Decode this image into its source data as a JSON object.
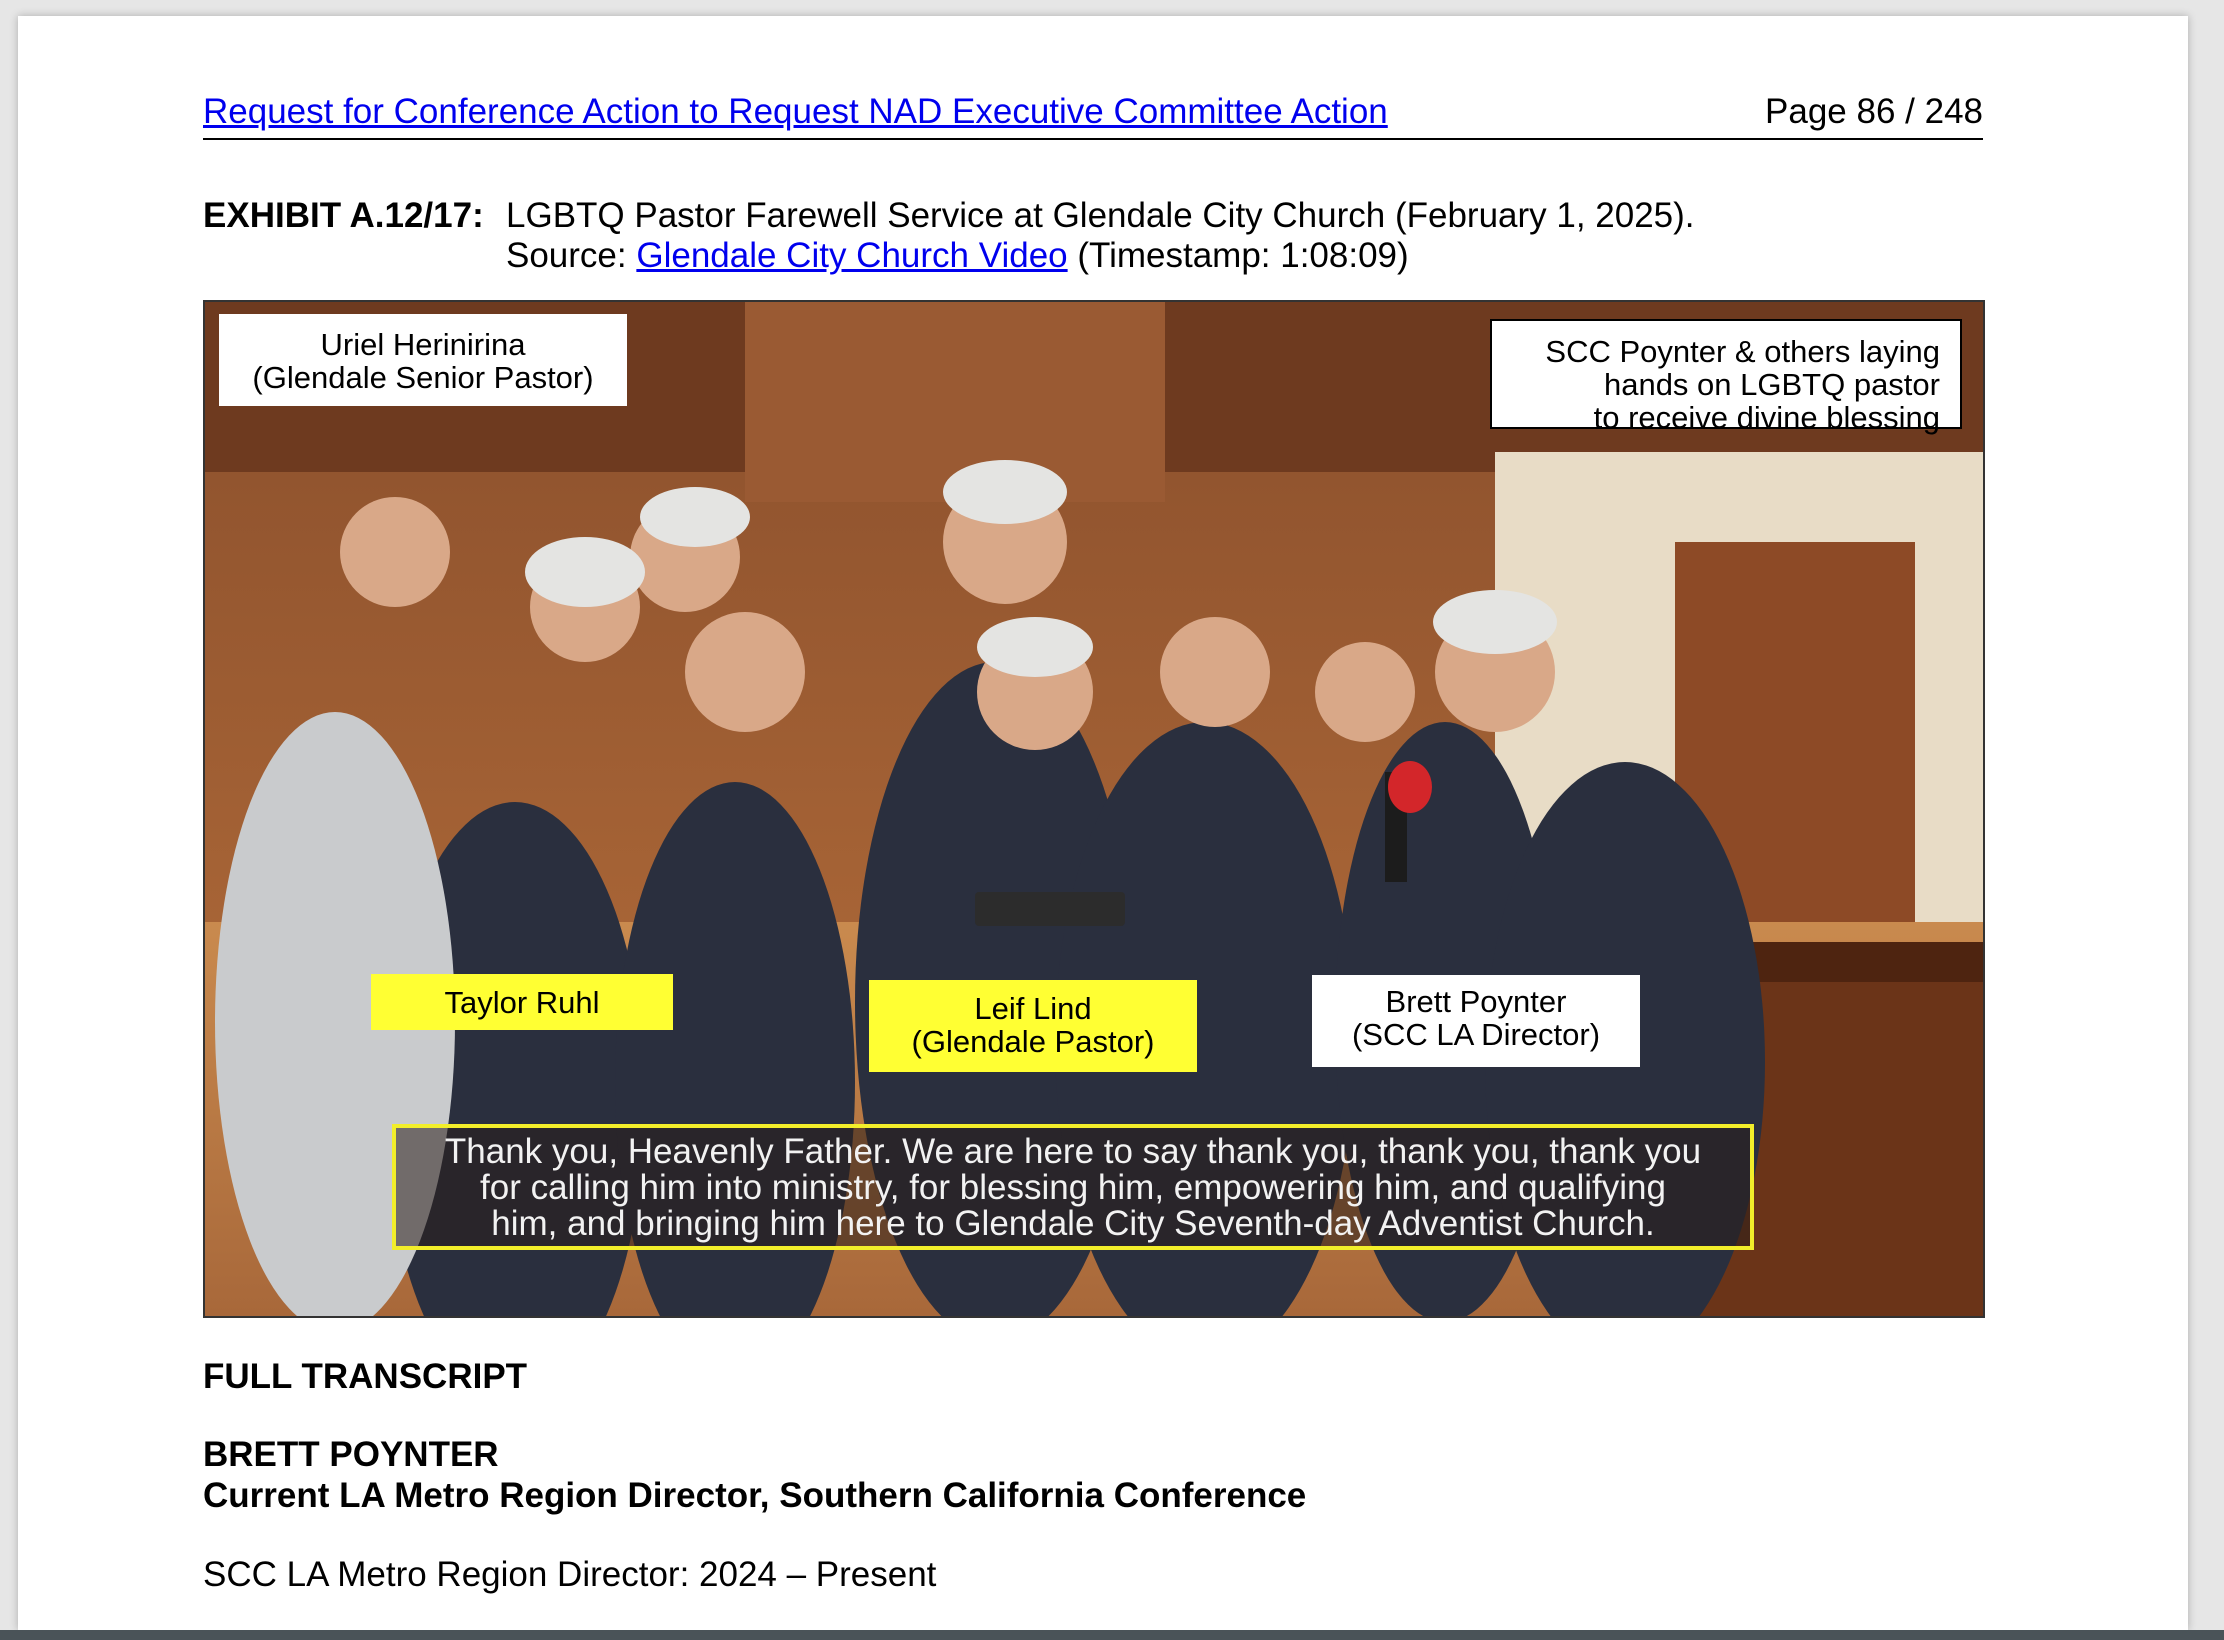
{
  "header": {
    "link_text": "Request for Conference Action to Request NAD Executive Committee Action",
    "page_number": "Page 86 / 248"
  },
  "exhibit": {
    "label": "EXHIBIT A.12/17:",
    "title": "LGBTQ Pastor Farewell Service at Glendale City Church (February 1, 2025).",
    "source_prefix": "Source: ",
    "source_link": "Glendale City Church Video",
    "timestamp": " (Timestamp: 1:08:09)"
  },
  "photo": {
    "labels": {
      "uriel_name": "Uriel Herinirina",
      "uriel_role": "(Glendale Senior Pastor)",
      "note_line1": "SCC Poynter & others laying",
      "note_line2": "hands on LGBTQ pastor",
      "note_line3": "to receive divine blessing",
      "taylor": "Taylor Ruhl",
      "leif_name": "Leif Lind",
      "leif_role": "(Glendale Pastor)",
      "brett_name": "Brett Poynter",
      "brett_role": "(SCC LA Director)"
    },
    "caption": {
      "line1": "Thank you, Heavenly Father. We are here to say thank you, thank you, thank you",
      "line2": "for calling him into ministry, for blessing him, empowering him, and qualifying",
      "line3": "him, and bringing him here to Glendale City Seventh-day Adventist Church."
    }
  },
  "transcript": {
    "heading": "FULL TRANSCRIPT",
    "speaker_name": "BRETT POYNTER",
    "speaker_title": "Current LA Metro Region Director, Southern California Conference",
    "tenure": "SCC LA Metro Region Director: 2024 – Present"
  },
  "colors": {
    "link": "#0000ee",
    "label_yellow": "#ffff33",
    "caption_border": "#f2ee2a"
  }
}
